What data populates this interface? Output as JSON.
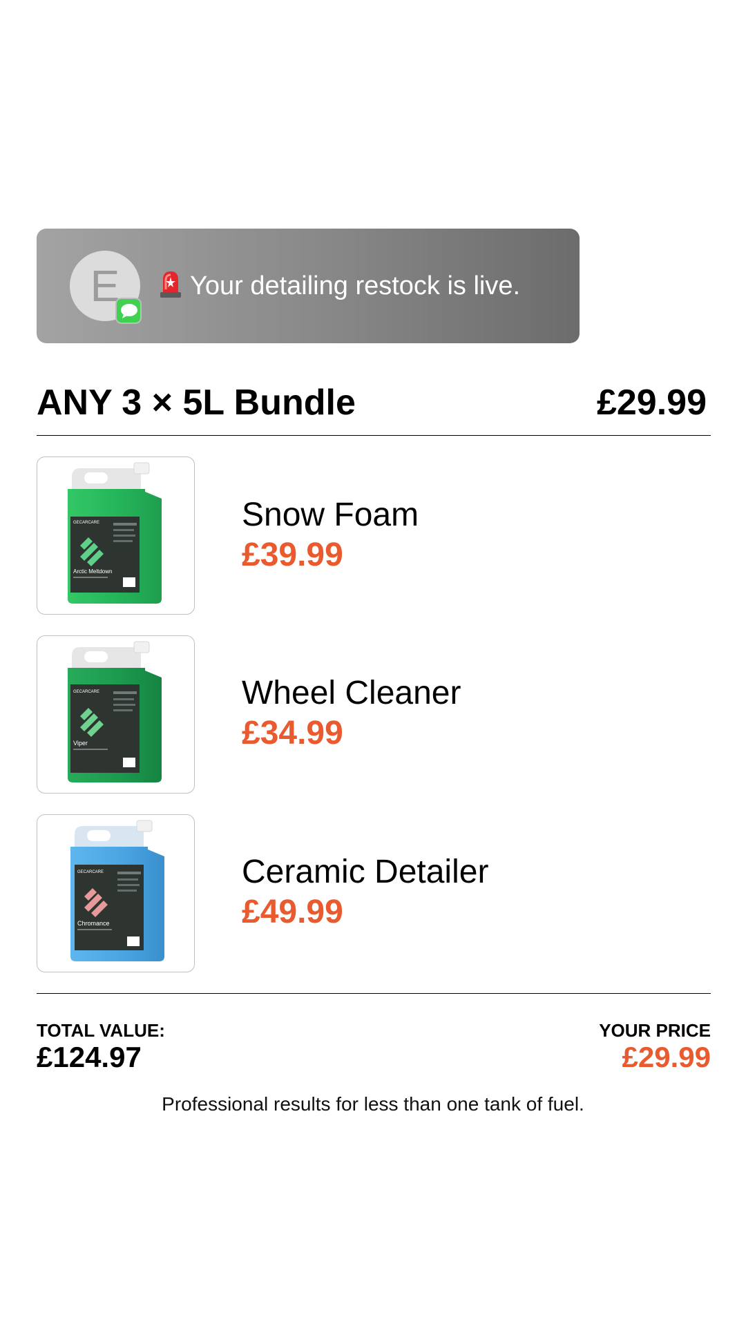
{
  "notification": {
    "avatar_letter": "E",
    "app_icon": "messages-icon",
    "emoji_icon": "police-light-icon",
    "message": "Your detailing restock is live."
  },
  "bundle": {
    "title": "ANY 3 × 5L Bundle",
    "price": "£29.99"
  },
  "products": [
    {
      "name": "Snow Foam",
      "price": "£39.99",
      "label_text": "Arctic Meltdown",
      "liquid_color": "#2fbf62",
      "brand": "GECARCARE"
    },
    {
      "name": "Wheel Cleaner",
      "price": "£34.99",
      "label_text": "Viper",
      "liquid_color": "#1fa556",
      "brand": "GECARCARE"
    },
    {
      "name": "Ceramic Detailer",
      "price": "£49.99",
      "label_text": "Chromance",
      "liquid_color": "#49a7e6",
      "brand": "GECARCARE"
    }
  ],
  "summary": {
    "total_label": "TOTAL VALUE:",
    "total_value": "£124.97",
    "your_price_label": "YOUR PRICE",
    "your_price_value": "£29.99",
    "tagline": "Professional results for less than one tank of fuel."
  },
  "colors": {
    "accent": "#ea5a2f"
  }
}
